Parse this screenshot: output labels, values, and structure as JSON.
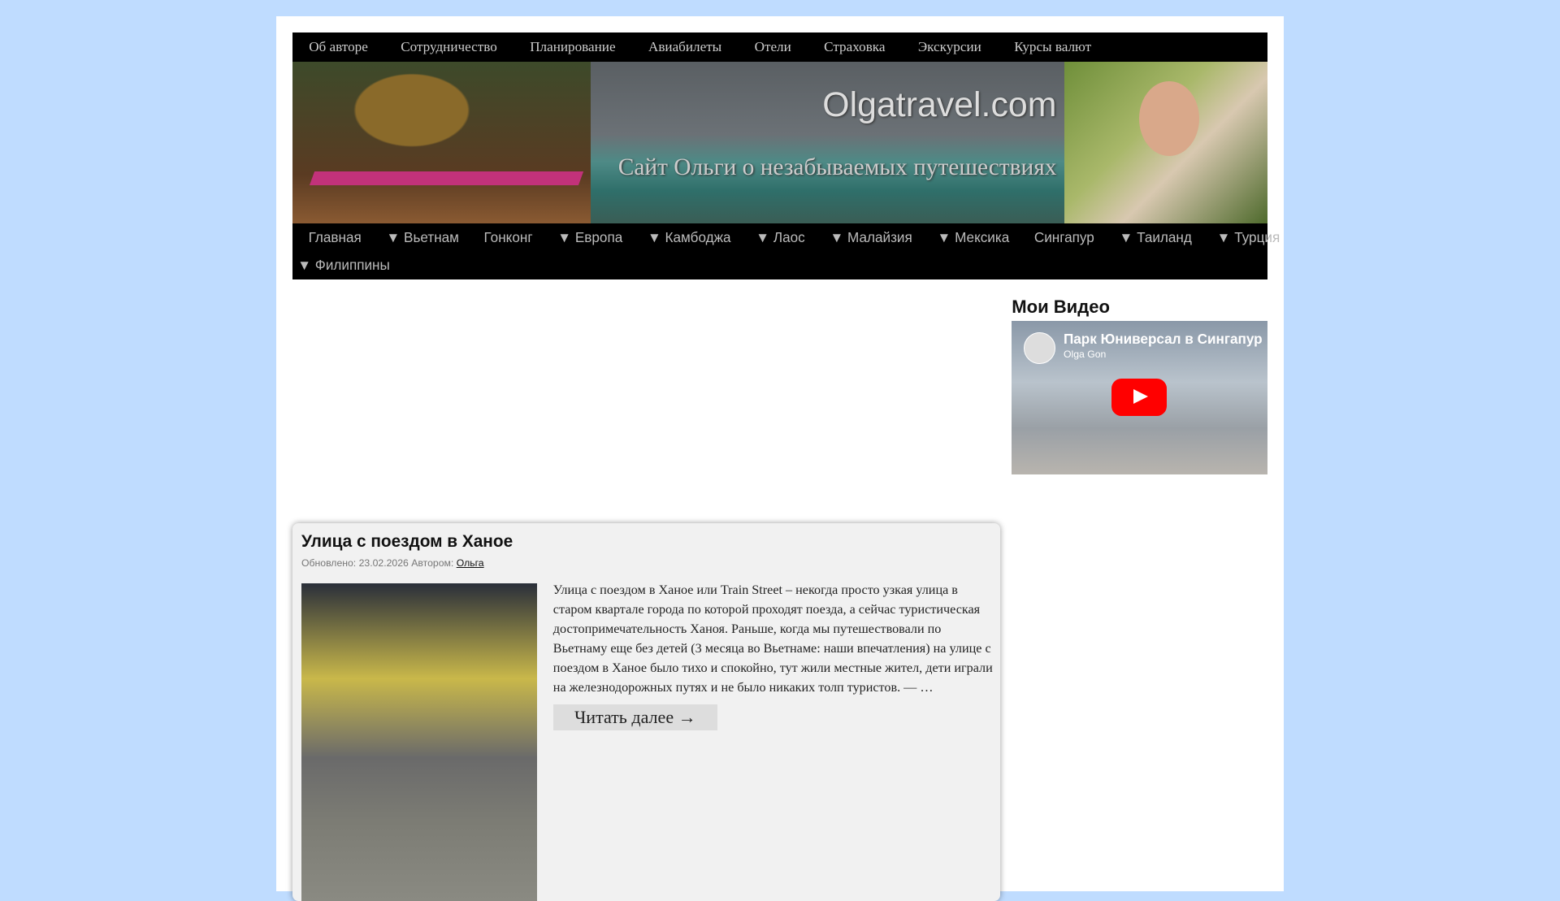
{
  "top_nav": [
    "Об авторе",
    "Сотрудничество",
    "Планирование",
    "Авиабилеты",
    "Отели",
    "Страховка",
    "Экскурсии",
    "Курсы валют"
  ],
  "header": {
    "title": "Olgatravel.com",
    "description": "Сайт Ольги о незабываемых путешествиях"
  },
  "main_nav": {
    "row1": [
      "Главная",
      "▼ Вьетнам",
      "Гонконг",
      "▼ Европа",
      "▼ Камбоджа",
      "▼ Лаос",
      "▼ Малайзия",
      "▼ Мексика",
      "Сингапур",
      "▼ Таиланд",
      "▼ Турция"
    ],
    "row2": [
      "▼ Филиппины"
    ]
  },
  "sidebar": {
    "heading": "Мои Видео",
    "video": {
      "title": "Парк Юниверсал в Сингапуре",
      "channel": "Olga Gon"
    }
  },
  "post": {
    "title": "Улица с поездом в Ханое",
    "meta_prefix": "Обновлено: 23.02.2026 Автором: ",
    "author": "Ольга",
    "excerpt": "Улица с поездом в Ханое или Train Street – некогда просто узкая улица в старом квартале города по которой проходят поезда, а сейчас туристическая достопримечательность Ханоя. Раньше, когда мы путешествовали по Вьетнаму еще без детей (3 месяца во Вьетнаме: наши впечатления) на улице с поездом в Ханое было тихо и спокойно, тут жили местные жител, дети играли на железнодорожных путях и не было никаких толп туристов. — …",
    "read_more": "Читать далее →"
  }
}
